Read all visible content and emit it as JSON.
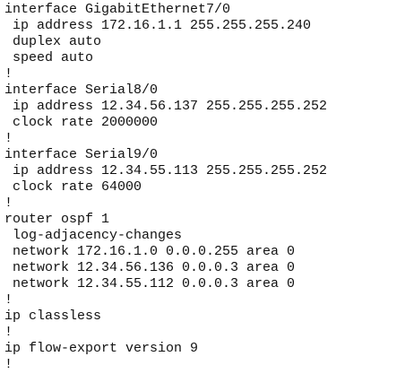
{
  "config": {
    "lines": [
      "interface GigabitEthernet7/0",
      " ip address 172.16.1.1 255.255.255.240",
      " duplex auto",
      " speed auto",
      "!",
      "interface Serial8/0",
      " ip address 12.34.56.137 255.255.255.252",
      " clock rate 2000000",
      "!",
      "interface Serial9/0",
      " ip address 12.34.55.113 255.255.255.252",
      " clock rate 64000",
      "!",
      "router ospf 1",
      " log-adjacency-changes",
      " network 172.16.1.0 0.0.0.255 area 0",
      " network 12.34.56.136 0.0.0.3 area 0",
      " network 12.34.55.112 0.0.0.3 area 0",
      "!",
      "ip classless",
      "!",
      "ip flow-export version 9",
      "!"
    ]
  }
}
